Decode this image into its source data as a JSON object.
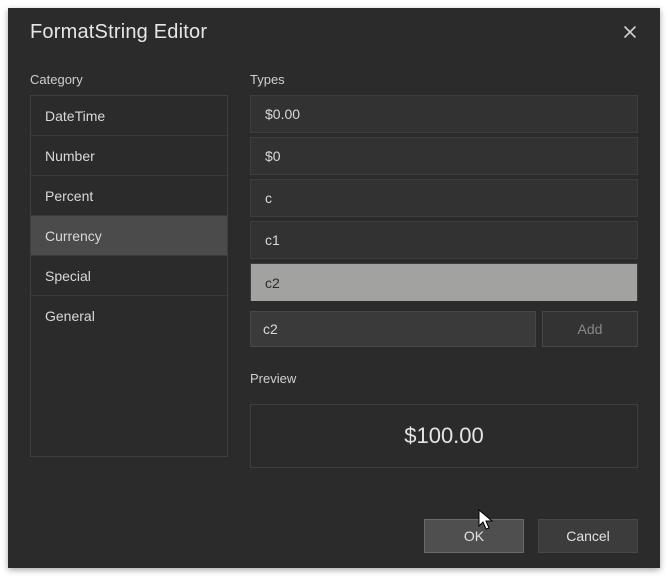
{
  "title": "FormatString Editor",
  "sections": {
    "category": "Category",
    "types": "Types",
    "preview": "Preview"
  },
  "categories": [
    {
      "label": "DateTime",
      "selected": false
    },
    {
      "label": "Number",
      "selected": false
    },
    {
      "label": "Percent",
      "selected": false
    },
    {
      "label": "Currency",
      "selected": true
    },
    {
      "label": "Special",
      "selected": false
    },
    {
      "label": "General",
      "selected": false
    }
  ],
  "types": [
    {
      "label": "$0.00",
      "selected": false
    },
    {
      "label": "$0",
      "selected": false
    },
    {
      "label": "c",
      "selected": false
    },
    {
      "label": "c1",
      "selected": false
    },
    {
      "label": "c2",
      "selected": true
    }
  ],
  "input_value": "c2",
  "buttons": {
    "add": "Add",
    "ok": "OK",
    "cancel": "Cancel"
  },
  "preview_value": "$100.00"
}
